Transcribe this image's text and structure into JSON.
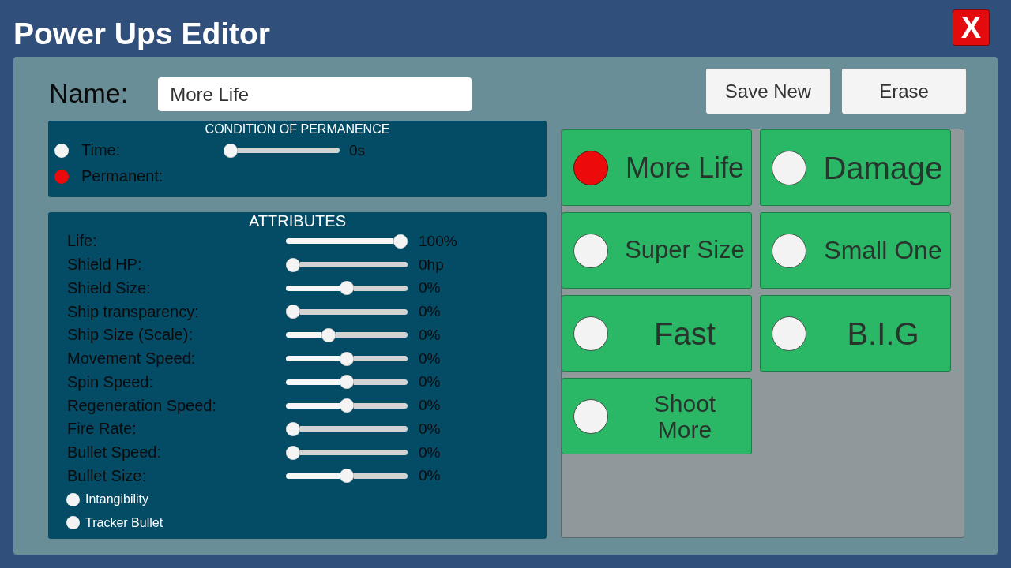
{
  "window": {
    "title": "Power Ups Editor",
    "close_button": "X"
  },
  "name_field": {
    "label": "Name:",
    "value": "More Life"
  },
  "save_button": "Save New",
  "erase_button": "Erase",
  "permanence": {
    "title": "CONDITION OF PERMANENCE",
    "options": [
      {
        "kind": "slider",
        "label": "Time:",
        "selected": false,
        "level": 0,
        "reading": "0s"
      },
      {
        "kind": "label",
        "label": "Permanent:",
        "selected": true
      }
    ]
  },
  "attributes": {
    "title": "ATTRIBUTES",
    "items": [
      {
        "kind": "slider",
        "label": "Life:",
        "level": 1,
        "reading": "100%"
      },
      {
        "kind": "slider",
        "label": "Shield HP:",
        "level": 0,
        "reading": "0hp"
      },
      {
        "kind": "slider",
        "label": "Shield Size:",
        "level": 0.5,
        "reading": "0%"
      },
      {
        "kind": "slider",
        "label": "Ship transparency:",
        "level": 0,
        "reading": "0%"
      },
      {
        "kind": "slider",
        "label": "Ship Size (Scale):",
        "level": 0.33,
        "reading": "0%"
      },
      {
        "kind": "slider",
        "label": "Movement Speed:",
        "level": 0.5,
        "reading": "0%"
      },
      {
        "kind": "slider",
        "label": "Spin Speed:",
        "level": 0.5,
        "reading": "0%"
      },
      {
        "kind": "slider",
        "label": "Regeneration Speed:",
        "level": 0.5,
        "reading": "0%"
      },
      {
        "kind": "slider",
        "label": "Fire Rate:",
        "level": 0,
        "reading": "0%"
      },
      {
        "kind": "slider",
        "label": "Bullet Speed:",
        "level": 0,
        "reading": "0%"
      },
      {
        "kind": "slider",
        "label": "Bullet Size:",
        "level": 0.5,
        "reading": "0%"
      },
      {
        "kind": "toggle",
        "label": "Intangibility",
        "checked": false
      },
      {
        "kind": "toggle",
        "label": "Tracker Bullet",
        "checked": false
      }
    ]
  },
  "power_ups": [
    {
      "label": "More Life",
      "selected": true
    },
    {
      "label": "Damage",
      "selected": false
    },
    {
      "label": "Super Size",
      "selected": false
    },
    {
      "label": "Small One",
      "selected": false
    },
    {
      "label": "Fast",
      "selected": false
    },
    {
      "label": "B.I.G",
      "selected": false
    },
    {
      "label": "Shoot More",
      "selected": false
    }
  ]
}
